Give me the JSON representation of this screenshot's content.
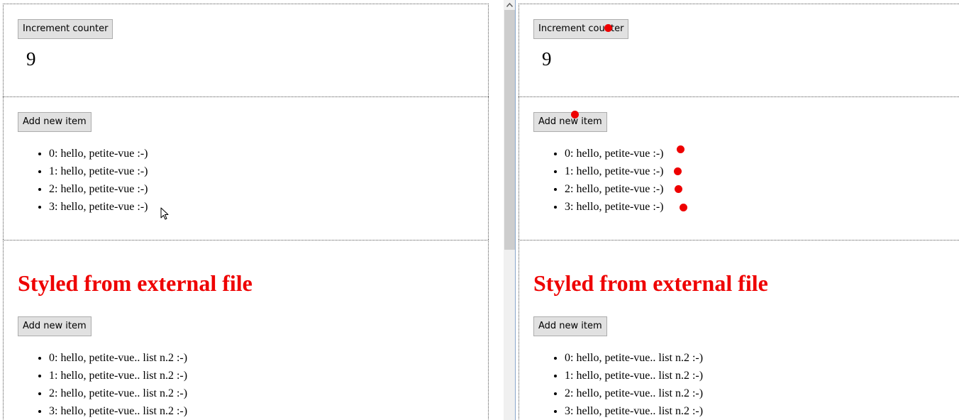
{
  "left": {
    "counter": {
      "button_label": "Increment counter",
      "value": "9"
    },
    "list1": {
      "button_label": "Add new item",
      "items": [
        "0: hello, petite-vue :-)",
        "1: hello, petite-vue :-)",
        "2: hello, petite-vue :-)",
        "3: hello, petite-vue :-)"
      ]
    },
    "list2": {
      "heading": "Styled from external file",
      "button_label": "Add new item",
      "items": [
        "0: hello, petite-vue.. list n.2 :-)",
        "1: hello, petite-vue.. list n.2 :-)",
        "2: hello, petite-vue.. list n.2 :-)",
        "3: hello, petite-vue.. list n.2 :-)"
      ]
    }
  },
  "right": {
    "counter": {
      "button_label": "Increment counter",
      "value": "9"
    },
    "list1": {
      "button_label": "Add new item",
      "items": [
        "0: hello, petite-vue :-)",
        "1: hello, petite-vue :-)",
        "2: hello, petite-vue :-)",
        "3: hello, petite-vue :-)"
      ]
    },
    "list2": {
      "heading": "Styled from external file",
      "button_label": "Add new item",
      "items": [
        "0: hello, petite-vue.. list n.2 :-)",
        "1: hello, petite-vue.. list n.2 :-)",
        "2: hello, petite-vue.. list n.2 :-)",
        "3: hello, petite-vue.. list n.2 :-)"
      ]
    }
  },
  "colors": {
    "heading": "#ee0000",
    "marker_dot": "#ee0000",
    "button_bg": "#e1e1e1",
    "button_border": "#adadad",
    "section_border": "#555555"
  },
  "icons": {
    "mouse_cursor": "arrow-cursor-icon",
    "scroll_up": "scroll-up-arrow-icon",
    "update_marker": "red-dot-icon"
  }
}
